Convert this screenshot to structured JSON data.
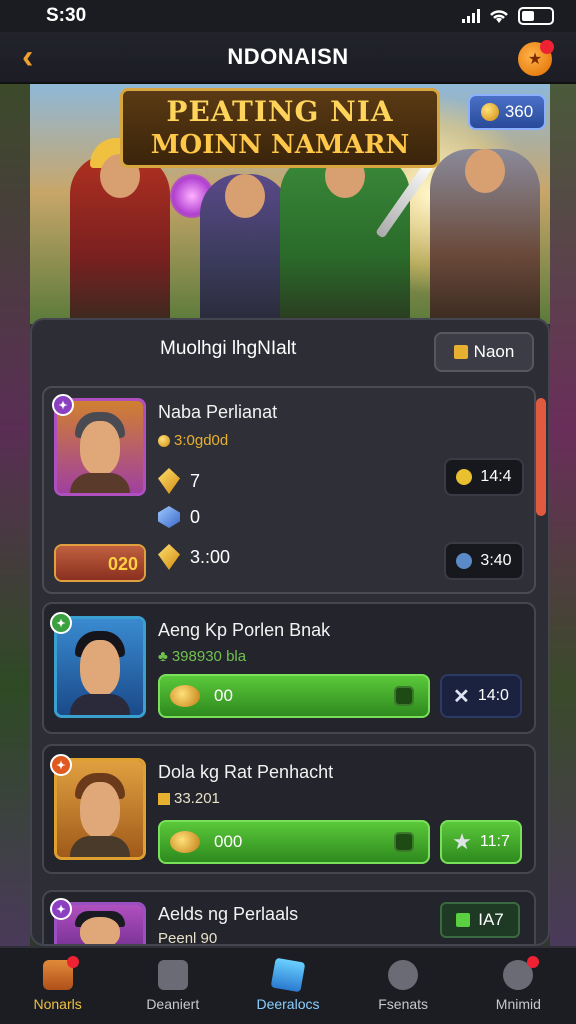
{
  "status_bar": {
    "time": "S:30"
  },
  "header": {
    "title": "NDONAISN"
  },
  "banner": {
    "title_line1": "PEATING NIA",
    "title_line2": "MOINN NAMARN",
    "currency_value": "360"
  },
  "profile": {
    "name": "Muolhgi lhgNIalt",
    "button_label": "Naon"
  },
  "cards": [
    {
      "title": "Naba Perlianat",
      "subtitle": "3:0gd0d",
      "stat1": "7",
      "stat2": "0",
      "stat3": "3.:00",
      "side_badge": "020",
      "pill1": "14:4",
      "pill2": "3:40"
    },
    {
      "title": "Aeng Kp Porlen Bnak",
      "subtitle": "398930 bla",
      "bar_value": "00",
      "side_value": "14:0"
    },
    {
      "title": "Dola kg Rat Penhacht",
      "subtitle": "33.201",
      "bar_value": "000",
      "side_value": "11:7"
    },
    {
      "title": "Aelds ng Perlaals",
      "subtitle": "Peenl 90",
      "side_value": "IA7"
    }
  ],
  "nav": [
    {
      "label": "Nonarls"
    },
    {
      "label": "Deaniert"
    },
    {
      "label": "Deeralocs"
    },
    {
      "label": "Fsenats"
    },
    {
      "label": "Mnimid"
    }
  ],
  "colors": {
    "accent": "#f0a030",
    "green": "#4ab82e",
    "panel": "#2c2d35"
  }
}
